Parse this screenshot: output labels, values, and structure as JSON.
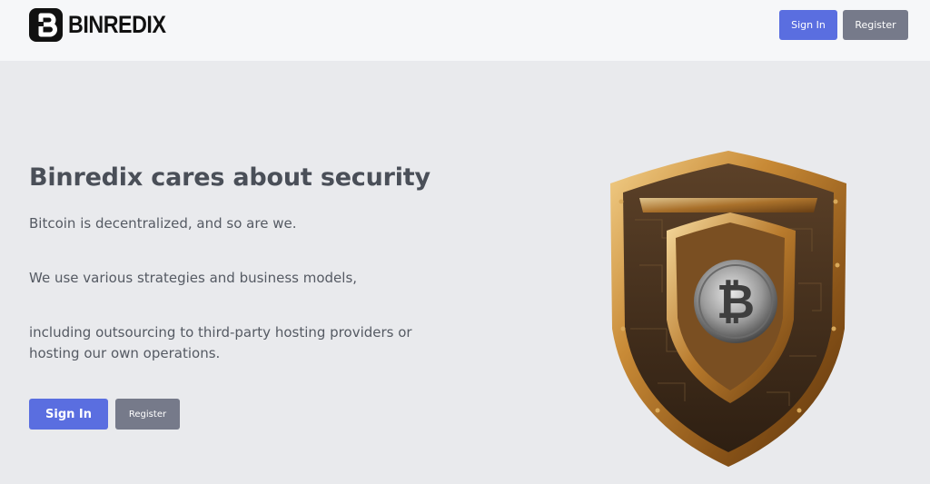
{
  "header": {
    "logo_text": "BINREDIX",
    "logo_icon": "binredix-b-icon",
    "signin_label": "Sign In",
    "register_label": "Register"
  },
  "hero": {
    "title": "Binredix cares about security",
    "line1": "Bitcoin is decentralized, and so are we.",
    "line2": "We use various strategies and business models,",
    "line3a": "including outsourcing to third-party hosting providers or",
    "line3b": "hosting our own operations.",
    "signin_label": "Sign In",
    "register_label": "Register",
    "image_icon": "bitcoin-security-shield-icon"
  },
  "colors": {
    "primary": "#5a6ee0",
    "secondary": "#767a8a",
    "header_bg": "#f6f7f9",
    "page_bg": "#e9eaed",
    "text": "#4a4f58"
  }
}
